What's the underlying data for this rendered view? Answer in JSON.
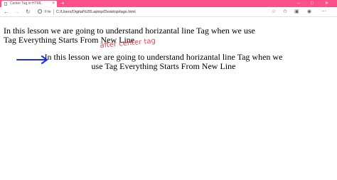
{
  "browser": {
    "tab_title": "Center Tag in HTML",
    "tab_close": "×",
    "new_tab": "+",
    "window_controls": {
      "minimize": "–",
      "maximize": "□",
      "close": "✕"
    },
    "nav": {
      "back": "←",
      "forward": "→",
      "refresh": "↻"
    },
    "address_label": "File",
    "address_url": "C:/Users/Digital%20Laptop/Desktop/tags.html",
    "toolbar_icons": [
      "star-icon",
      "favorites-icon",
      "collections-icon",
      "profile-icon",
      "menu-icon"
    ],
    "accent_color": "#ff4f8b"
  },
  "page": {
    "paragraph_1": "In this lesson we are going to understand horizantal line Tag when we use Tag Everything Starts From New Line",
    "paragraph_2": "In this lesson we are going to understand horizantal line Tag when we use Tag Everything Starts From New Line"
  },
  "annotation": {
    "text": "after center tag",
    "text_color": "#e8424f",
    "arrow_color": "#1a2de8"
  }
}
